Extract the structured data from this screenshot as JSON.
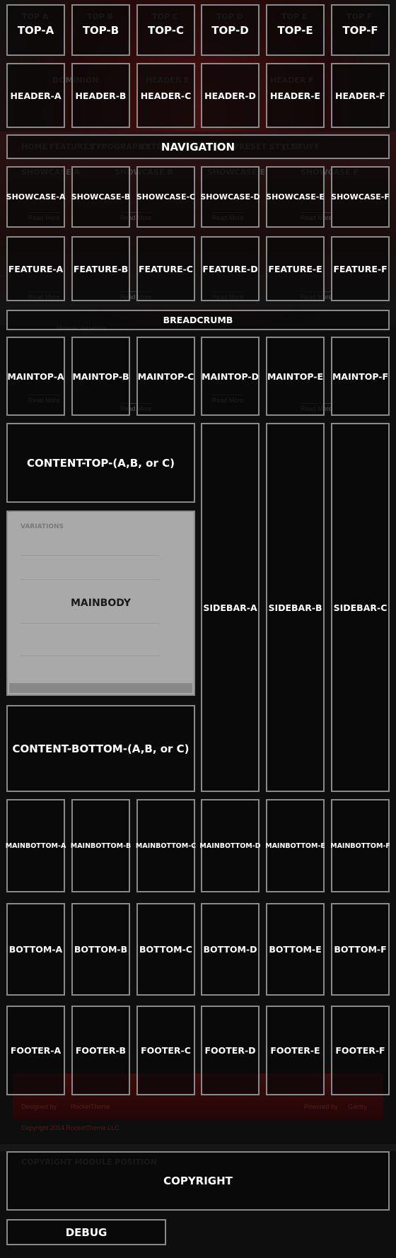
{
  "positions": {
    "top": [
      "TOP-A",
      "TOP-B",
      "TOP-C",
      "TOP-D",
      "TOP-E",
      "TOP-F"
    ],
    "header": [
      "HEADER-A",
      "HEADER-B",
      "HEADER-C",
      "HEADER-D",
      "HEADER-E",
      "HEADER-F"
    ],
    "navigation": "NAVIGATION",
    "showcase": [
      "SHOWCASE-A",
      "SHOWCASE-B",
      "SHOWCASE-C",
      "SHOWCASE-D",
      "SHOWCASE-E",
      "SHOWCASE-F"
    ],
    "feature": [
      "FEATURE-A",
      "FEATURE-B",
      "FEATURE-C",
      "FEATURE-D",
      "FEATURE-E",
      "FEATURE-F"
    ],
    "breadcrumb": "BREADCRUMB",
    "maintop": [
      "MAINTOP-A",
      "MAINTOP-B",
      "MAINTOP-C",
      "MAINTOP-D",
      "MAINTOP-E",
      "MAINTOP-F"
    ],
    "content_top": "CONTENT-TOP-(A,B, or C)",
    "mainbody": "MAINBODY",
    "content_bottom": "CONTENT-BOTTOM-(A,B, or C)",
    "sidebar": [
      "SIDEBAR-A",
      "SIDEBAR-B",
      "SIDEBAR-C"
    ],
    "mainbottom": [
      "MAINBOTTOM-A",
      "MAINBOTTOM-B",
      "MAINBOTTOM-C",
      "MAINBOTTOM-D",
      "MAINBOTTOM-E",
      "MAINBOTTOM-F"
    ],
    "bottom": [
      "BOTTOM-A",
      "BOTTOM-B",
      "BOTTOM-C",
      "BOTTOM-D",
      "BOTTOM-E",
      "BOTTOM-F"
    ],
    "footer": [
      "FOOTER-A",
      "FOOTER-B",
      "FOOTER-C",
      "FOOTER-D",
      "FOOTER-E",
      "FOOTER-F"
    ],
    "copyright": "COPYRIGHT",
    "debug": "DEBUG"
  },
  "background": {
    "top_titles": [
      "TOP A",
      "TOP B",
      "TOP C",
      "TOP D",
      "TOP E",
      "TOP F"
    ],
    "logo": "dominion",
    "header_titles": [
      "HEADER E",
      "HEADER F"
    ],
    "nav_items": [
      "HOME",
      "FEATURES",
      "TYPOGRAPHY",
      "EXTENSIONS",
      "PRESET STYLES",
      "J! STUFF"
    ],
    "showcase_titles": [
      "SHOWCASE A",
      "SHOWCASE B",
      "SHOWCASE E",
      "SHOWCASE F"
    ],
    "read_more": "Read More",
    "breadcrumb_text": "Module Variations",
    "mainbody_heading": "VARIATIONS",
    "mainbody_posted": "Posted by",
    "mainbody_author": "administrator",
    "powered_left": "Designed by",
    "rockettheme": "RocketTheme",
    "powered_right": "Powered by",
    "gantry": "Gantry",
    "copyright_line": "Copyright 2014 RocketTheme LLC",
    "copyright_heading": "COPYRIGHT MODULE POSITION"
  },
  "colors": {
    "accent": "#4a1010",
    "block_border": "#8a8a8a",
    "mainbody_fill": "#a9a9a9",
    "label": "#ffffff"
  }
}
